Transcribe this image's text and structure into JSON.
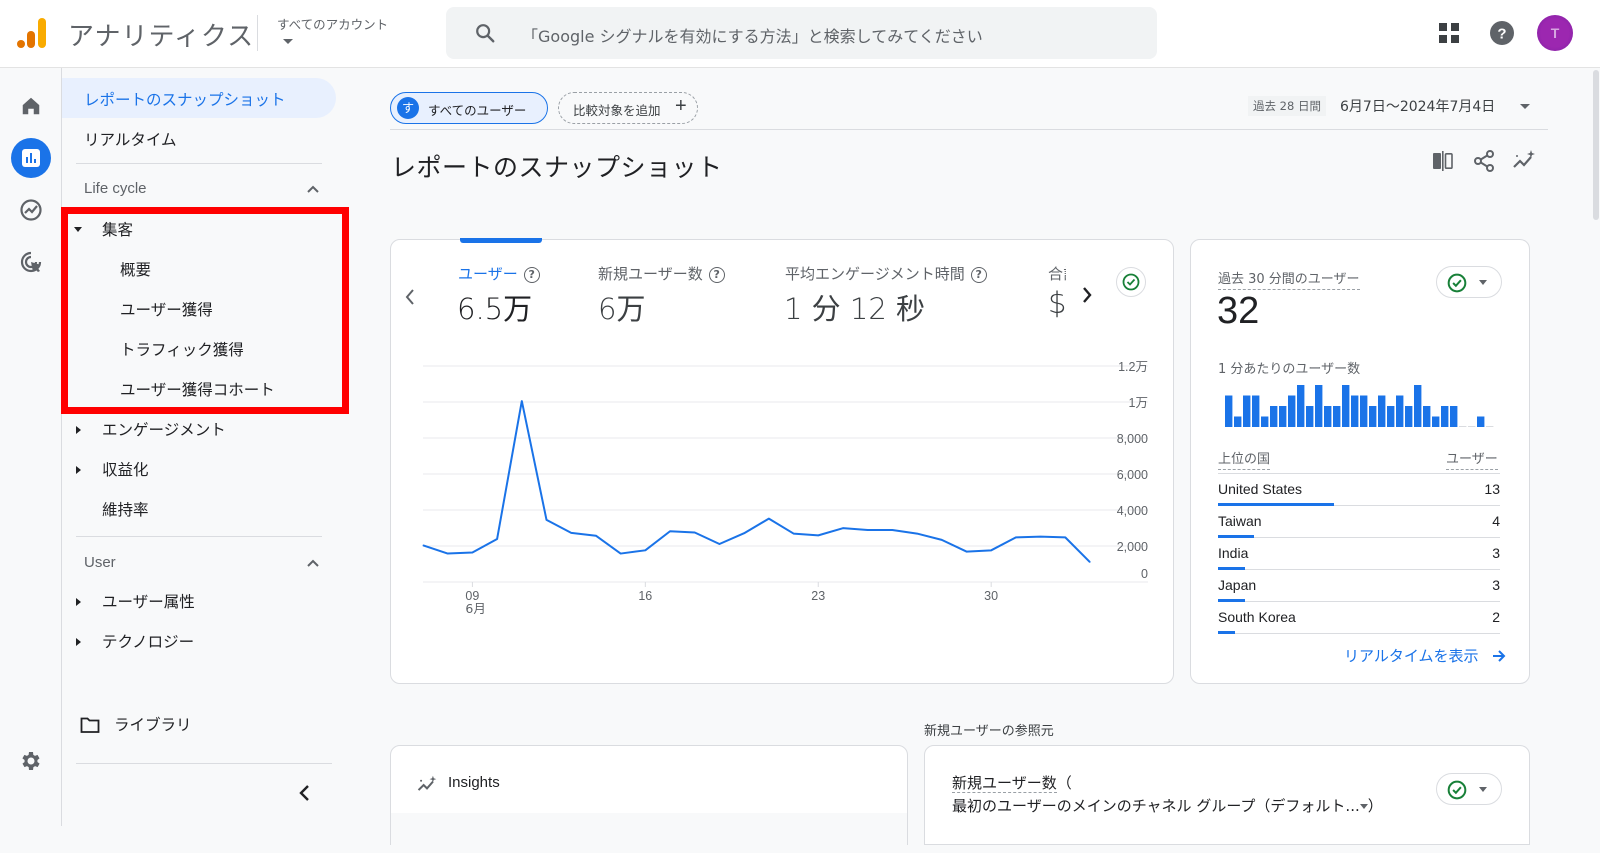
{
  "header": {
    "app_title": "アナリティクス",
    "account_label": "すべてのアカウント",
    "search_placeholder": "「Google シグナルを有効にする方法」と検索してみてください",
    "avatar_initial": "T",
    "icons": [
      "apps-grid-icon",
      "help-icon",
      "avatar"
    ]
  },
  "rail": {
    "items": [
      {
        "name": "home",
        "icon": "home-icon",
        "active": false
      },
      {
        "name": "reports",
        "icon": "bar-chart-icon",
        "active": true
      },
      {
        "name": "explore",
        "icon": "explore-trend-icon",
        "active": false
      },
      {
        "name": "advertising",
        "icon": "target-cursor-icon",
        "active": false
      }
    ],
    "settings_icon": "gear-icon"
  },
  "sidenav": {
    "active_item": "レポートのスナップショット",
    "realtime": "リアルタイム",
    "lifecycle_section": "Life cycle",
    "acquisition": {
      "label": "集客",
      "children": [
        "概要",
        "ユーザー獲得",
        "トラフィック獲得",
        "ユーザー獲得コホート"
      ]
    },
    "engagement": "エンゲージメント",
    "monetization": "収益化",
    "retention": "維持率",
    "user_section": "User",
    "demographics": "ユーザー属性",
    "technology": "テクノロジー",
    "library": "ライブラリ"
  },
  "toolbar": {
    "segment_badge": "す",
    "segment_label": "すべてのユーザー",
    "add_comparison": "比較対象を追加",
    "date_preset": "過去 28 日間",
    "date_range": "6月7日～2024年7月4日"
  },
  "page_title": "レポートのスナップショット",
  "metrics": [
    {
      "label": "ユーザー",
      "value": "6.5万",
      "active": true
    },
    {
      "label": "新規ユーザー数",
      "value": "6万",
      "active": false
    },
    {
      "label": "平均エンゲージメント時間",
      "value": "1 分 12 秒",
      "active": false
    },
    {
      "label": "合計",
      "value": "$",
      "active": false
    }
  ],
  "chart_data": {
    "type": "line",
    "title": "ユーザー",
    "x": [
      "06-07",
      "06-08",
      "06-09",
      "06-10",
      "06-11",
      "06-12",
      "06-13",
      "06-14",
      "06-15",
      "06-16",
      "06-17",
      "06-18",
      "06-19",
      "06-20",
      "06-21",
      "06-22",
      "06-23",
      "06-24",
      "06-25",
      "06-26",
      "06-27",
      "06-28",
      "06-29",
      "06-30",
      "07-01",
      "07-02",
      "07-03",
      "07-04"
    ],
    "series": [
      {
        "name": "ユーザー",
        "color": "#1a73e8",
        "values": [
          2040,
          1580,
          1640,
          2390,
          10050,
          3450,
          2730,
          2570,
          1580,
          1760,
          2820,
          2750,
          2110,
          2710,
          3520,
          2690,
          2590,
          2990,
          2890,
          2890,
          2690,
          2340,
          1690,
          1760,
          2480,
          2520,
          2480,
          1100
        ]
      }
    ],
    "x_ticks": [
      {
        "index": 2,
        "label": "09",
        "sub": "6月"
      },
      {
        "index": 9,
        "label": "16"
      },
      {
        "index": 16,
        "label": "23"
      },
      {
        "index": 23,
        "label": "30"
      }
    ],
    "y_ticks": [
      {
        "value": 12000,
        "label": "1.2万"
      },
      {
        "value": 10000,
        "label": "1万"
      },
      {
        "value": 8000,
        "label": "8,000"
      },
      {
        "value": 6000,
        "label": "6,000"
      },
      {
        "value": 4000,
        "label": "4,000"
      },
      {
        "value": 2000,
        "label": "2,000"
      },
      {
        "value": 0,
        "label": "0"
      }
    ],
    "ylim": [
      0,
      12000
    ],
    "grid": true,
    "y_axis_side": "right",
    "xlabel": "",
    "ylabel": ""
  },
  "realtime": {
    "label": "過去 30 分間のユーザー",
    "value": "32",
    "per_minute_label": "1 分あたりのユーザー数",
    "per_minute_values": [
      3,
      1,
      3,
      3,
      1,
      2,
      2,
      3,
      4,
      2,
      4,
      2,
      2,
      4,
      3,
      3,
      2,
      3,
      2,
      3,
      2,
      4,
      2,
      1,
      2,
      2,
      0,
      0,
      1,
      0
    ],
    "countries_header": "上位の国",
    "users_header": "ユーザー",
    "countries": [
      {
        "name": "United States",
        "users": "13",
        "share": 1.0
      },
      {
        "name": "Taiwan",
        "users": "4",
        "share": 0.31
      },
      {
        "name": "India",
        "users": "3",
        "share": 0.23
      },
      {
        "name": "Japan",
        "users": "3",
        "share": 0.23
      },
      {
        "name": "South Korea",
        "users": "2",
        "share": 0.15
      }
    ],
    "view_realtime": "リアルタイムを表示"
  },
  "bottom": {
    "insights_title": "Insights",
    "source_caption": "新規ユーザーの参照元",
    "source_title_line1": "新規ユーザー数",
    "source_title_paren": "（",
    "source_title_line2": "最初のユーザーのメインのチャネル グループ（デフォルト...",
    "source_title_close": "）"
  },
  "colors": {
    "accent": "#1a73e8",
    "highlight": "#ff0000",
    "success": "#188038"
  }
}
